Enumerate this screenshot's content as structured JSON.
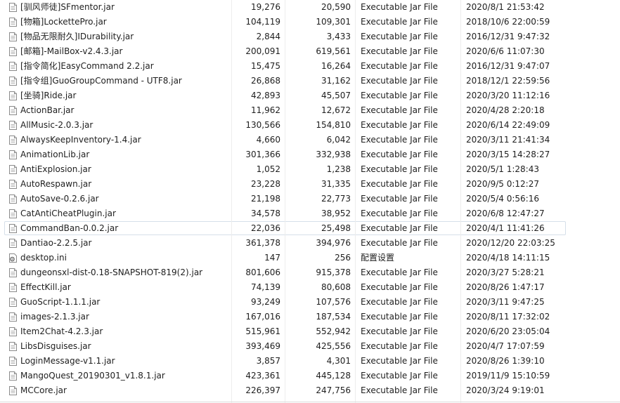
{
  "files": [
    {
      "name": "[驯风师徒]SFmentor.jar",
      "size": "19,276",
      "packed": "20,590",
      "type": "Executable Jar File",
      "modified": "2020/8/1 21:53:42",
      "icon": "jar-file-icon"
    },
    {
      "name": "[物箱]LockettePro.jar",
      "size": "104,119",
      "packed": "109,301",
      "type": "Executable Jar File",
      "modified": "2018/10/6 22:00:59",
      "icon": "jar-file-icon"
    },
    {
      "name": "[物品无限耐久]IDurability.jar",
      "size": "2,844",
      "packed": "3,433",
      "type": "Executable Jar File",
      "modified": "2016/12/31 9:47:32",
      "icon": "jar-file-icon"
    },
    {
      "name": "[邮箱]-MailBox-v2.4.3.jar",
      "size": "200,091",
      "packed": "619,561",
      "type": "Executable Jar File",
      "modified": "2020/6/6 11:07:30",
      "icon": "jar-file-icon"
    },
    {
      "name": "[指令简化]EasyCommand 2.2.jar",
      "size": "15,475",
      "packed": "16,264",
      "type": "Executable Jar File",
      "modified": "2016/12/31 9:47:07",
      "icon": "jar-file-icon"
    },
    {
      "name": "[指令组]GuoGroupCommand - UTF8.jar",
      "size": "26,868",
      "packed": "31,162",
      "type": "Executable Jar File",
      "modified": "2018/12/1 22:59:56",
      "icon": "jar-file-icon"
    },
    {
      "name": "[坐骑]Ride.jar",
      "size": "42,893",
      "packed": "45,507",
      "type": "Executable Jar File",
      "modified": "2020/3/20 11:12:16",
      "icon": "jar-file-icon"
    },
    {
      "name": "ActionBar.jar",
      "size": "11,962",
      "packed": "12,672",
      "type": "Executable Jar File",
      "modified": "2020/4/28 2:20:18",
      "icon": "jar-file-icon"
    },
    {
      "name": "AllMusic-2.0.3.jar",
      "size": "130,566",
      "packed": "154,810",
      "type": "Executable Jar File",
      "modified": "2020/6/14 22:49:09",
      "icon": "jar-file-icon"
    },
    {
      "name": "AlwaysKeepInventory-1.4.jar",
      "size": "4,660",
      "packed": "6,042",
      "type": "Executable Jar File",
      "modified": "2020/3/11 21:41:34",
      "icon": "jar-file-icon"
    },
    {
      "name": "AnimationLib.jar",
      "size": "301,366",
      "packed": "332,938",
      "type": "Executable Jar File",
      "modified": "2020/3/15 14:28:27",
      "icon": "jar-file-icon"
    },
    {
      "name": "AntiExplosion.jar",
      "size": "1,052",
      "packed": "1,238",
      "type": "Executable Jar File",
      "modified": "2020/5/1 1:28:43",
      "icon": "jar-file-icon"
    },
    {
      "name": "AutoRespawn.jar",
      "size": "23,228",
      "packed": "31,335",
      "type": "Executable Jar File",
      "modified": "2020/9/5 0:12:27",
      "icon": "jar-file-icon"
    },
    {
      "name": "AutoSave-0.2.6.jar",
      "size": "21,198",
      "packed": "22,773",
      "type": "Executable Jar File",
      "modified": "2020/5/4 0:56:16",
      "icon": "jar-file-icon"
    },
    {
      "name": "CatAntiCheatPlugin.jar",
      "size": "34,578",
      "packed": "38,952",
      "type": "Executable Jar File",
      "modified": "2020/6/8 12:47:27",
      "icon": "jar-file-icon"
    },
    {
      "name": "CommandBan-0.0.2.jar",
      "size": "22,036",
      "packed": "25,498",
      "type": "Executable Jar File",
      "modified": "2020/4/1 11:41:26",
      "icon": "jar-file-icon",
      "selected": true
    },
    {
      "name": "Dantiao-2.2.5.jar",
      "size": "361,378",
      "packed": "394,976",
      "type": "Executable Jar File",
      "modified": "2020/12/20 22:03:25",
      "icon": "jar-file-icon"
    },
    {
      "name": "desktop.ini",
      "size": "147",
      "packed": "256",
      "type": "配置设置",
      "modified": "2020/4/18 14:11:15",
      "icon": "settings-file-icon"
    },
    {
      "name": "dungeonsxl-dist-0.18-SNAPSHOT-819(2).jar",
      "size": "801,606",
      "packed": "915,378",
      "type": "Executable Jar File",
      "modified": "2020/3/27 5:28:21",
      "icon": "jar-file-icon"
    },
    {
      "name": "EffectKill.jar",
      "size": "74,139",
      "packed": "80,608",
      "type": "Executable Jar File",
      "modified": "2020/8/26 1:47:17",
      "icon": "jar-file-icon"
    },
    {
      "name": "GuoScript-1.1.1.jar",
      "size": "93,249",
      "packed": "107,576",
      "type": "Executable Jar File",
      "modified": "2020/3/11 9:47:25",
      "icon": "jar-file-icon"
    },
    {
      "name": "images-2.1.3.jar",
      "size": "167,016",
      "packed": "187,534",
      "type": "Executable Jar File",
      "modified": "2020/8/11 17:32:02",
      "icon": "jar-file-icon"
    },
    {
      "name": "Item2Chat-4.2.3.jar",
      "size": "515,961",
      "packed": "552,942",
      "type": "Executable Jar File",
      "modified": "2020/6/20 23:05:04",
      "icon": "jar-file-icon"
    },
    {
      "name": "LibsDisguises.jar",
      "size": "393,469",
      "packed": "425,556",
      "type": "Executable Jar File",
      "modified": "2020/4/7 17:07:59",
      "icon": "jar-file-icon"
    },
    {
      "name": "LoginMessage-v1.1.jar",
      "size": "3,857",
      "packed": "4,301",
      "type": "Executable Jar File",
      "modified": "2020/8/26 1:39:10",
      "icon": "jar-file-icon"
    },
    {
      "name": "MangoQuest_20190301_v1.8.1.jar",
      "size": "423,361",
      "packed": "445,128",
      "type": "Executable Jar File",
      "modified": "2019/11/9 15:10:59",
      "icon": "jar-file-icon"
    },
    {
      "name": "MCCore.jar",
      "size": "226,397",
      "packed": "247,756",
      "type": "Executable Jar File",
      "modified": "2020/3/24 9:19:01",
      "icon": "jar-file-icon"
    }
  ]
}
